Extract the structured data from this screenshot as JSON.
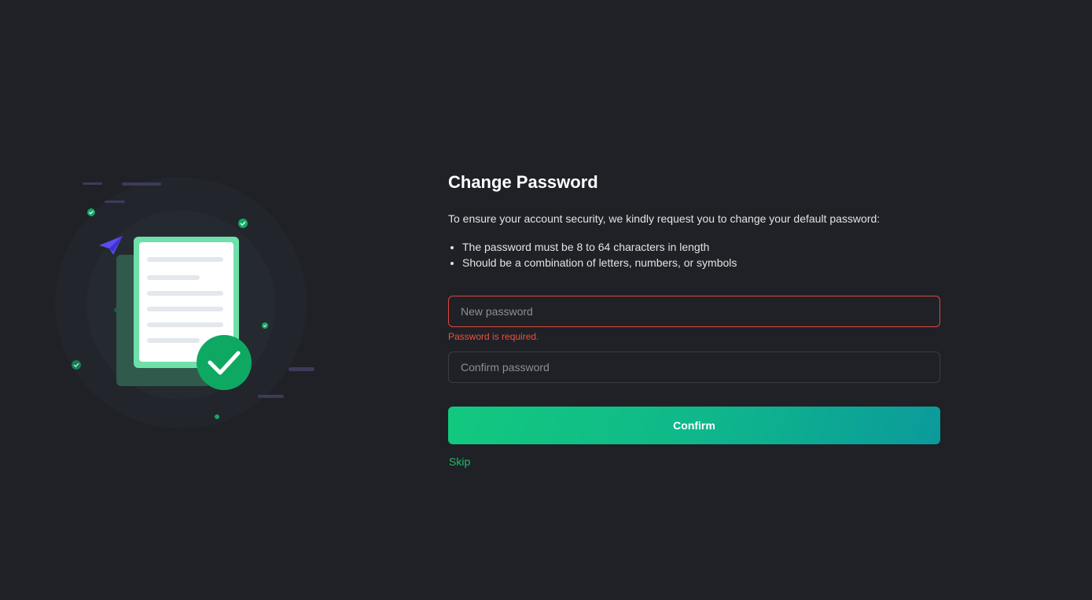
{
  "form": {
    "title": "Change Password",
    "intro": "To ensure your account security, we kindly request you to change your default password:",
    "rules": [
      "The password must be 8 to 64 characters in length",
      "Should be a combination of letters, numbers, or symbols"
    ],
    "new_password": {
      "placeholder": "New password",
      "value": "",
      "error": "Password is required."
    },
    "confirm_password": {
      "placeholder": "Confirm password",
      "value": ""
    },
    "confirm_label": "Confirm",
    "skip_label": "Skip"
  },
  "colors": {
    "background": "#1f2126",
    "accent": "#1fbf6e",
    "error": "#f0503c",
    "button_start": "#12c97f",
    "button_end": "#0b9a9c"
  },
  "icons": {
    "illustration": "document-check-illustration",
    "paper_plane": "paper-plane-icon",
    "check": "check-circle-icon"
  }
}
